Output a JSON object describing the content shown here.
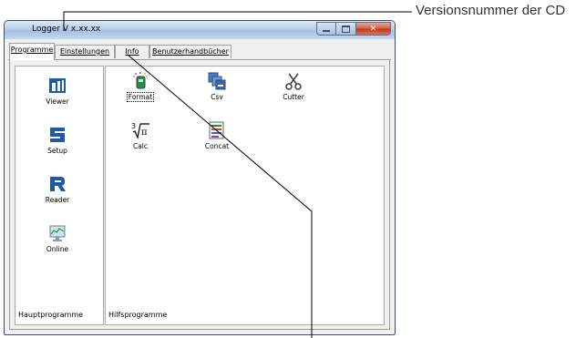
{
  "annotation": {
    "label": "Versionsnummer der CD"
  },
  "window": {
    "title": "Logger V x.xx.xx",
    "tabs": [
      {
        "label": "Programme",
        "active": true
      },
      {
        "label": "Einstellungen",
        "active": false
      },
      {
        "label": "Info",
        "active": false
      },
      {
        "label": "Benutzerhandbücher",
        "active": false
      }
    ],
    "main_programs": {
      "section_label": "Hauptprogramme",
      "items": [
        {
          "label": "Viewer",
          "icon": "viewer-icon"
        },
        {
          "label": "Setup",
          "icon": "setup-icon"
        },
        {
          "label": "Reader",
          "icon": "reader-icon"
        },
        {
          "label": "Online",
          "icon": "online-monitor-icon"
        }
      ]
    },
    "helper_programs": {
      "section_label": "Hilfsprogramme",
      "items": [
        {
          "label": "Format",
          "icon": "format-icon"
        },
        {
          "label": "Csv",
          "icon": "csv-icon"
        },
        {
          "label": "Cutter",
          "icon": "scissors-icon"
        },
        {
          "label": "Calc",
          "icon": "calc-root-icon"
        },
        {
          "label": "Concat",
          "icon": "concat-icon"
        }
      ]
    }
  },
  "colors": {
    "accent": "#1e5aa8",
    "close": "#c1391c"
  }
}
